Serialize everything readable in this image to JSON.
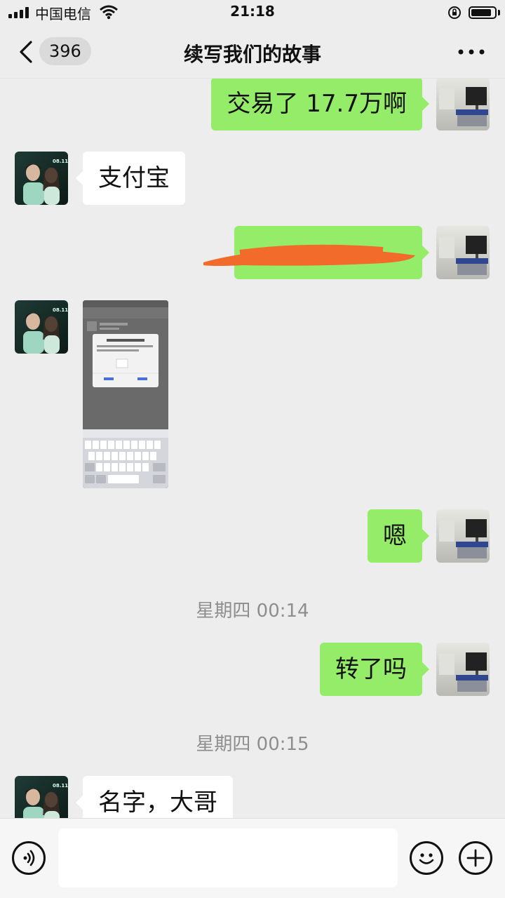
{
  "status_bar": {
    "carrier": "中国电信",
    "time": "21:18"
  },
  "nav": {
    "unread_count": "396",
    "title": "续写我们的故事"
  },
  "messages": [
    {
      "side": "right",
      "text": "交易了 17.7万啊"
    },
    {
      "side": "left",
      "text": "支付宝"
    },
    {
      "side": "right",
      "text": "",
      "note": "redacted"
    },
    {
      "side": "left",
      "type": "image"
    },
    {
      "side": "right",
      "text": "嗯"
    },
    {
      "type": "time",
      "text": "星期四 00:14"
    },
    {
      "side": "right",
      "text": "转了吗"
    },
    {
      "type": "time",
      "text": "星期四 00:15"
    },
    {
      "side": "left",
      "text": "名字，大哥"
    }
  ],
  "colors": {
    "background": "#ededed",
    "sent_bubble": "#95ec69",
    "received_bubble": "#ffffff",
    "redaction_mark": "#f26b2a"
  },
  "icons": [
    "back-icon",
    "more-icon",
    "voice-icon",
    "emoji-icon",
    "plus-icon"
  ]
}
